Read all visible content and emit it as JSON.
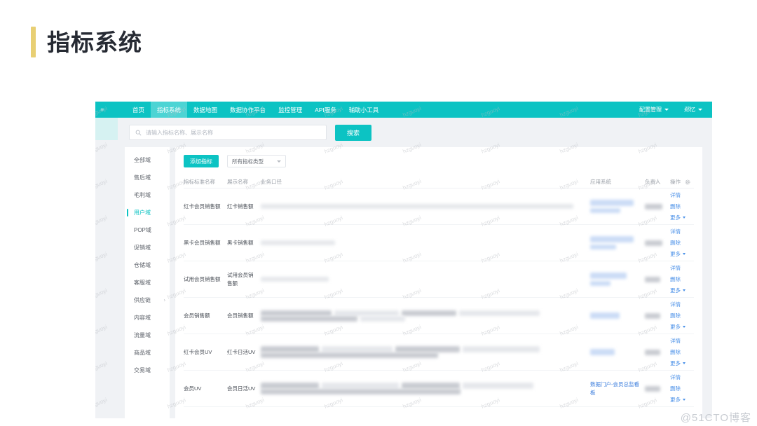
{
  "slide": {
    "title": "指标系统",
    "accent_color": "#e8cf74"
  },
  "watermark": {
    "tile_text": "hzguoyi",
    "footer_text": "@51CTO博客"
  },
  "theme": {
    "primary": "#0cc3c3",
    "link": "#4a90e8",
    "text": "#4a4f57"
  },
  "topnav": {
    "items": [
      {
        "label": "首页",
        "active": false
      },
      {
        "label": "指标系统",
        "active": true
      },
      {
        "label": "数据地图",
        "active": false
      },
      {
        "label": "数据协作平台",
        "active": false
      },
      {
        "label": "监控管理",
        "active": false
      },
      {
        "label": "API服务",
        "active": false
      },
      {
        "label": "辅助小工具",
        "active": false
      }
    ],
    "right": [
      {
        "label": "配置管理"
      },
      {
        "label": "郑忆"
      }
    ]
  },
  "search": {
    "placeholder": "请输入指标名称、展示名称",
    "value": "",
    "button_label": "搜索",
    "icon": "search-icon"
  },
  "sidebar": {
    "items": [
      {
        "label": "全部域",
        "active": false,
        "expandable": false
      },
      {
        "label": "售后域",
        "active": false,
        "expandable": false
      },
      {
        "label": "毛利域",
        "active": false,
        "expandable": false
      },
      {
        "label": "用户域",
        "active": true,
        "expandable": false
      },
      {
        "label": "POP域",
        "active": false,
        "expandable": false
      },
      {
        "label": "促销域",
        "active": false,
        "expandable": false
      },
      {
        "label": "仓储域",
        "active": false,
        "expandable": false
      },
      {
        "label": "客服域",
        "active": false,
        "expandable": false
      },
      {
        "label": "供应链",
        "active": false,
        "expandable": true,
        "arrow": "›"
      },
      {
        "label": "内容域",
        "active": false,
        "expandable": false
      },
      {
        "label": "流量域",
        "active": false,
        "expandable": false
      },
      {
        "label": "商品域",
        "active": false,
        "expandable": false
      },
      {
        "label": "交易域",
        "active": false,
        "expandable": false
      }
    ]
  },
  "toolbar": {
    "add_label": "添加指标",
    "type_filter_value": "所有指标类型",
    "type_filter_icon": "chevron-down-icon"
  },
  "table": {
    "columns": {
      "standard_name": "指标标准名称",
      "display_name": "展示名称",
      "caliber": "业务口径",
      "app_system": "应用系统",
      "owner": "负责人",
      "actions": "操作"
    },
    "settings_icon": "gear-icon",
    "actions": {
      "detail": "详情",
      "delete": "删除",
      "more": "更多"
    },
    "rows": [
      {
        "standard_name": "红卡会员销售额",
        "display_name": "红卡销售额",
        "caliber_redacted": true,
        "app_system": "",
        "app_system_redacted": true,
        "owner_redacted": true
      },
      {
        "standard_name": "黑卡会员销售额",
        "display_name": "黑卡销售额",
        "caliber_redacted": true,
        "app_system": "",
        "app_system_redacted": true,
        "owner_redacted": true
      },
      {
        "standard_name": "试用会员销售额",
        "display_name": "试用会员销售额",
        "caliber_redacted": true,
        "app_system": "",
        "app_system_redacted": true,
        "owner_redacted": true
      },
      {
        "standard_name": "会员销售额",
        "display_name": "会员销售额",
        "caliber_redacted": true,
        "app_system": "",
        "app_system_redacted": true,
        "owner_redacted": true
      },
      {
        "standard_name": "红卡会员UV",
        "display_name": "红卡日活UV",
        "caliber_redacted": true,
        "app_system": "",
        "app_system_redacted": true,
        "owner_redacted": true
      },
      {
        "standard_name": "会员UV",
        "display_name": "会员日活UV",
        "caliber_redacted": true,
        "app_system": "数据门户-会员总监看板",
        "app_system_redacted": false,
        "owner_redacted": true
      }
    ]
  }
}
